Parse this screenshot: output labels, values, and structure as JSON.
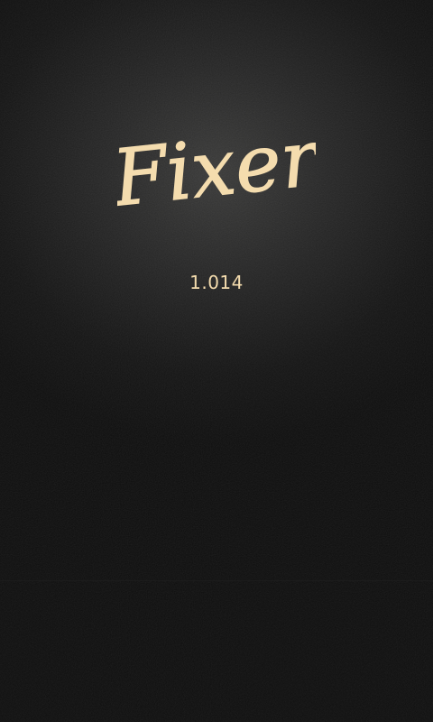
{
  "app": {
    "title": "Fixer",
    "version": "1.014"
  },
  "colors": {
    "accent": "#f4dcae",
    "background": "#111111"
  }
}
